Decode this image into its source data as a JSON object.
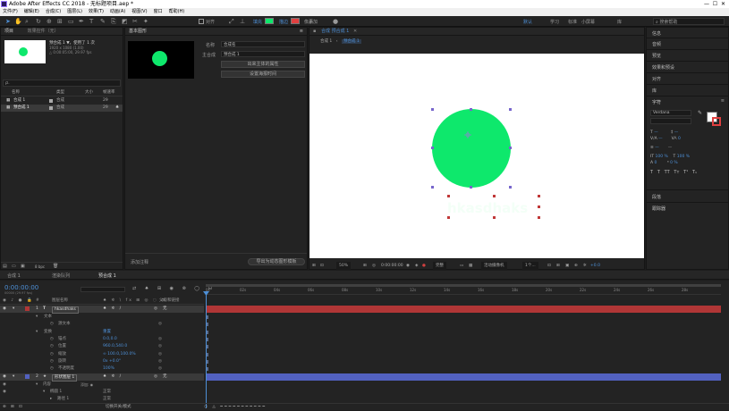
{
  "app": {
    "title": "Adobe After Effects CC 2018 - 无标题项目.aep *"
  },
  "menu": [
    "文件(F)",
    "编辑(E)",
    "合成(C)",
    "图层(L)",
    "效果(T)",
    "动画(A)",
    "视图(V)",
    "窗口",
    "帮助(H)"
  ],
  "toolbar": {
    "snap_label": "对齐",
    "fill_label": "填充",
    "stroke_label": "描边",
    "px_label": "像素",
    "add_label": "添加",
    "workspace": [
      "默认",
      "学习",
      "标准",
      "小屏幕",
      "库"
    ],
    "search_placeholder": "搜索帮助"
  },
  "project": {
    "tab": "项目",
    "tab2": "效果控件（无）",
    "comp_name": "预合成 1 ▼，使用了 1 次",
    "comp_info1": "1920 x 1080 (1.00)",
    "comp_info2": "△ 0:00:05:00, 29.97 fps",
    "search_placeholder": "ρ.",
    "col_name": "名称",
    "col_type": "类型",
    "col_size": "大小",
    "col_fps": "帧速率",
    "items": [
      {
        "name": "合成 1",
        "type": "合成",
        "fps": "29"
      },
      {
        "name": "预合成 1",
        "type": "合成",
        "fps": "29"
      }
    ],
    "bpc": "8 bpc"
  },
  "essential": {
    "tab": "基本图形",
    "name_label": "名称",
    "name_value": "合成名",
    "master_label": "主合成",
    "master_value": "预合成 1",
    "btn1": "出来主体的属性",
    "btn2": "设置海报时间",
    "footer_left": "添加注释",
    "footer_right": "导出为动态图形模板"
  },
  "composition": {
    "tab": "合成 预合成 1",
    "crumb1": "合成 1",
    "crumb2": "预合成 1",
    "overlay_text": "hkasdhaks",
    "zoom": "50%",
    "time": "0:00:00:00",
    "quality": "完整",
    "camera": "活动摄像机",
    "views": "1个...",
    "exposure": "+0.0"
  },
  "right": {
    "items": [
      "信息",
      "音频",
      "预览",
      "效果和预设",
      "对齐",
      "库"
    ],
    "char_tab": "字符",
    "font": "Verdana",
    "paragraph_tab": "段落",
    "tracker_tab": "跟踪器",
    "fill_color": "#ffffff",
    "stroke_color": "#e04040"
  },
  "timeline": {
    "tabs": [
      "合成 1",
      "渲染队列",
      "预合成 1"
    ],
    "timecode": "0:00:00:00",
    "timecode_sub": "00000 (29.97 fps)",
    "col_layer": "图层名称",
    "col_parent": "父级和链接",
    "layers": [
      {
        "num": "1",
        "name": "hkasdhaks",
        "parent": "无",
        "mode": "无"
      },
      {
        "num": "2",
        "name": "形状图层 1",
        "parent": "无",
        "mode": "无"
      }
    ],
    "props": [
      {
        "label": "文本",
        "value": "",
        "indent": 1
      },
      {
        "label": "源文本",
        "value": "",
        "indent": 2
      },
      {
        "label": "变换",
        "value": "重置",
        "indent": 1
      },
      {
        "label": "锚点",
        "value": "0.0,0.0",
        "indent": 2
      },
      {
        "label": "位置",
        "value": "960.0,540.0",
        "indent": 2
      },
      {
        "label": "缩放",
        "value": "∞ 100.0,100.0%",
        "indent": 2
      },
      {
        "label": "旋转",
        "value": "0x +0.0°",
        "indent": 2
      },
      {
        "label": "不透明度",
        "value": "100%",
        "indent": 2
      }
    ],
    "layer2_props": [
      {
        "label": "内容",
        "value": "",
        "mode": "正常"
      },
      {
        "label": "椭圆 1",
        "value": "",
        "mode": "正常"
      },
      {
        "label": "路径 1",
        "value": ""
      }
    ],
    "ruler": [
      "0s",
      "02s",
      "04s",
      "06s",
      "08s",
      "10s",
      "12s",
      "14s",
      "16s",
      "18s",
      "20s",
      "22s",
      "24s",
      "26s",
      "28s"
    ],
    "footer": "切换开关/模式"
  },
  "colors": {
    "circle": "#0ee86c",
    "accent_blue": "#4d8fd6",
    "red_bar": "#b03636",
    "blue_bar": "#5261c0"
  }
}
